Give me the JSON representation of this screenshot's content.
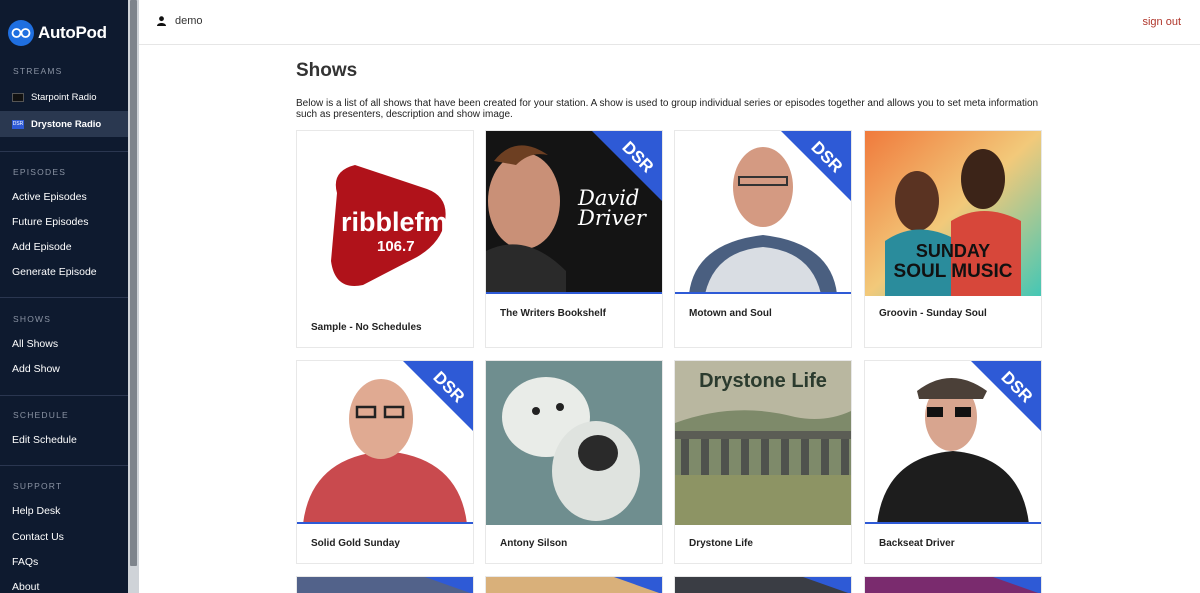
{
  "app": {
    "logo_text": "AutoPod"
  },
  "sidebar": {
    "streams_label": "STREAMS",
    "streams": [
      {
        "label": "Starpoint Radio",
        "icon": "starpoint-radio-icon"
      },
      {
        "label": "Drystone Radio",
        "icon": "dsr-logo-icon",
        "badge": "DSR"
      }
    ],
    "episodes_label": "EPISODES",
    "episodes": [
      "Active Episodes",
      "Future Episodes",
      "Add Episode",
      "Generate Episode"
    ],
    "shows_label": "SHOWS",
    "shows": [
      "All Shows",
      "Add Show"
    ],
    "schedule_label": "SCHEDULE",
    "schedule": [
      "Edit Schedule"
    ],
    "support_label": "SUPPORT",
    "support": [
      "Help Desk",
      "Contact Us",
      "FAQs",
      "About"
    ]
  },
  "topbar": {
    "username": "demo",
    "signout": "sign out"
  },
  "main": {
    "title": "Shows",
    "description": "Below is a list of all shows that have been created for your station. A show is used to group individual series or episodes together and allows you to set meta information such as presenters, description and show image.",
    "shows": [
      {
        "name": "Sample - No Schedules",
        "image_text_1": "ribblefm",
        "image_text_2": "106.7"
      },
      {
        "name": "The Writers Bookshelf",
        "image_text_1": "David",
        "image_text_2": "Driver",
        "corner": "DSR"
      },
      {
        "name": "Motown and Soul",
        "corner": "DSR"
      },
      {
        "name": "Groovin - Sunday Soul",
        "image_text_1": "SUNDAY",
        "image_text_2": "SOUL MUSIC"
      },
      {
        "name": "Solid Gold Sunday",
        "corner": "DSR"
      },
      {
        "name": "Antony Silson"
      },
      {
        "name": "Drystone Life",
        "image_text_1": "Drystone Life"
      },
      {
        "name": "Backseat Driver",
        "corner": "DSR"
      }
    ]
  },
  "colors": {
    "sidebar_bg": "#0e1a2f",
    "accent": "#2e5ad6",
    "signout": "#b0362b"
  }
}
